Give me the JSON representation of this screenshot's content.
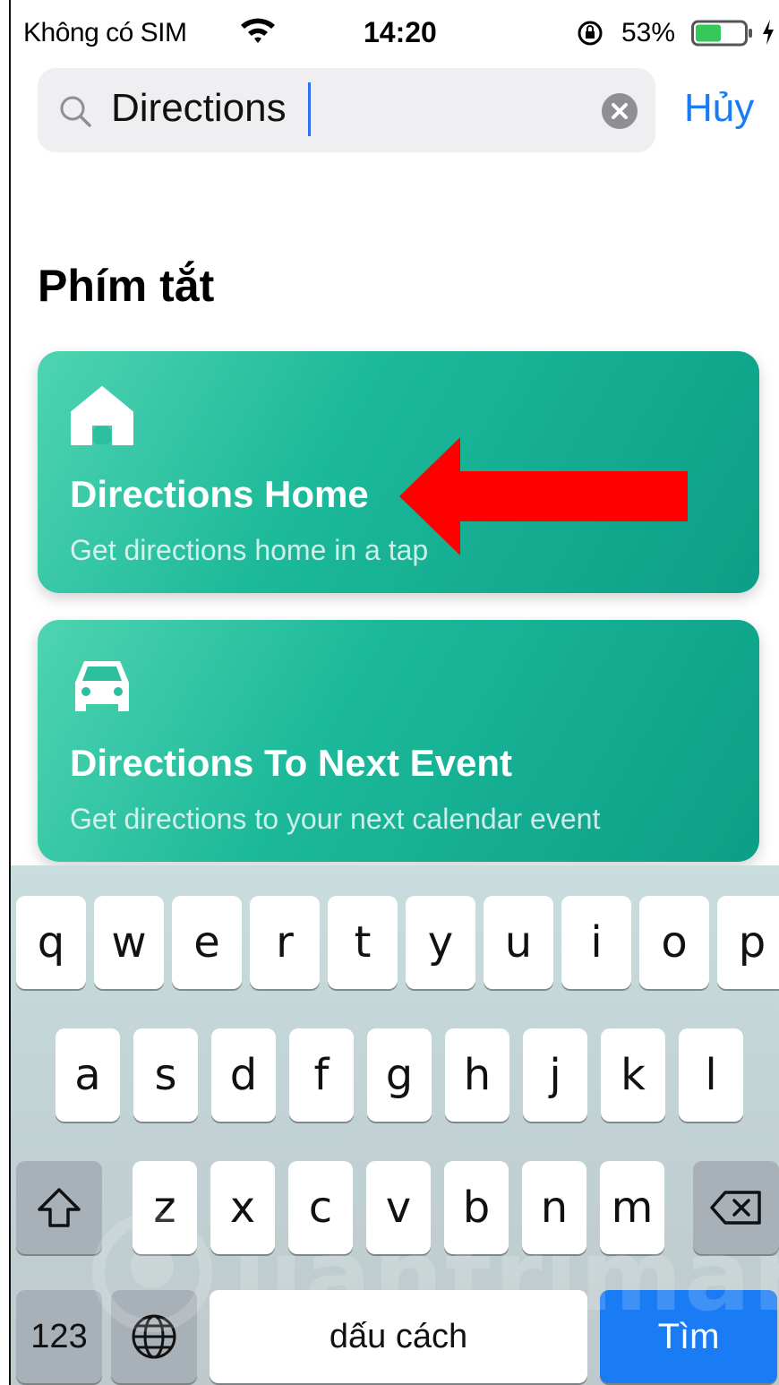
{
  "status_bar": {
    "carrier": "Không có SIM",
    "time": "14:20",
    "battery_percent": "53%",
    "battery_level": 0.53,
    "icons": [
      "wifi-icon",
      "orientation-lock-icon",
      "battery-icon",
      "charging-bolt-icon"
    ]
  },
  "search": {
    "query": "Directions",
    "cancel_label": "Hủy",
    "icons": [
      "search-icon",
      "clear-icon"
    ]
  },
  "section_title": "Phím tắt",
  "shortcuts": [
    {
      "icon": "house-icon",
      "title": "Directions Home",
      "subtitle": "Get directions home in a tap"
    },
    {
      "icon": "car-icon",
      "title": "Directions To Next Event",
      "subtitle": "Get directions to your next calendar event"
    }
  ],
  "annotation": {
    "icon": "red-arrow-icon",
    "color": "#ff0000"
  },
  "keyboard": {
    "row1": [
      "q",
      "w",
      "e",
      "r",
      "t",
      "y",
      "u",
      "i",
      "o",
      "p"
    ],
    "row2": [
      "a",
      "s",
      "d",
      "f",
      "g",
      "h",
      "j",
      "k",
      "l"
    ],
    "row3": [
      "z",
      "x",
      "c",
      "v",
      "b",
      "n",
      "m"
    ],
    "numbers_label": "123",
    "space_label": "dấu cách",
    "go_label": "Tìm",
    "icons": [
      "shift-icon",
      "delete-icon",
      "globe-icon"
    ]
  },
  "watermark": "uantrimang",
  "colors": {
    "accent": "#1a7cf5",
    "card": "#1cb99a",
    "battery": "#34c759"
  }
}
